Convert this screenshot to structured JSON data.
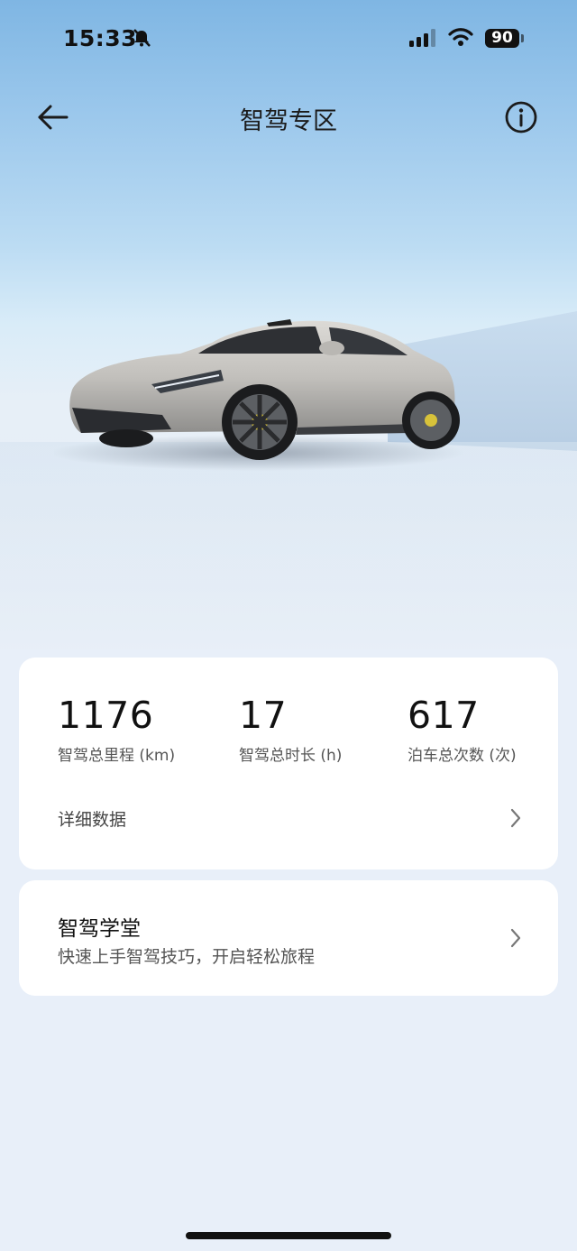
{
  "status_bar": {
    "time": "15:33",
    "battery": "90",
    "icons": [
      "bell-muted-icon",
      "signal-icon",
      "wifi-icon",
      "battery-icon"
    ]
  },
  "nav": {
    "title": "智驾专区",
    "back_icon": "arrow-left-icon",
    "info_icon": "info-circle-icon"
  },
  "hero": {
    "image": "silver-sedan-car-image"
  },
  "stats": {
    "items": [
      {
        "value": "1176",
        "label": "智驾总里程 (km)"
      },
      {
        "value": "17",
        "label": "智驾总时长 (h)"
      },
      {
        "value": "617",
        "label": "泊车总次数 (次)"
      }
    ],
    "detail_label": "详细数据"
  },
  "academy": {
    "title": "智驾学堂",
    "subtitle": "快速上手智驾技巧，开启轻松旅程"
  },
  "colors": {
    "background": "#e8eff9",
    "card": "#ffffff",
    "sky_top": "#7fb6e3"
  }
}
